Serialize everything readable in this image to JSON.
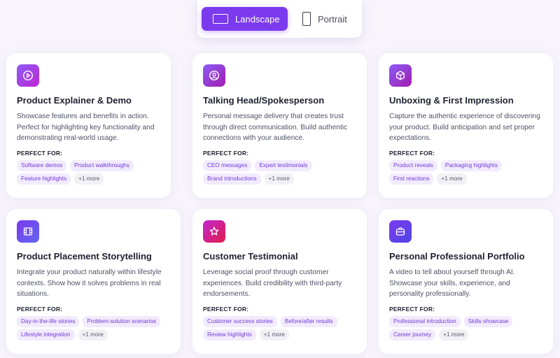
{
  "toggle": {
    "landscape_label": "Landscape",
    "portrait_label": "Portrait",
    "selected": "Landscape"
  },
  "colors": {
    "accent": "#7c3aed",
    "tag_bg": "#f2ebfd",
    "tag_text": "#7238d6",
    "page_bg": "#f7f4fc"
  },
  "perfect_for_label": "PERFECT FOR:",
  "cards": [
    {
      "icon": "play-circle-icon",
      "title": "Product Explainer & Demo",
      "description": "Showcase features and benefits in action. Perfect for highlighting key functionality and demonstrating real-world usage.",
      "tags": [
        "Software demos",
        "Product walkthroughs",
        "Feature highlights"
      ],
      "more": "+1 more"
    },
    {
      "icon": "user-circle-icon",
      "title": "Talking Head/Spokesperson",
      "description": "Personal message delivery that creates trust through direct communication. Build authentic connections with your audience.",
      "tags": [
        "CEO messages",
        "Expert testimonials",
        "Brand introductions"
      ],
      "more": "+1 more"
    },
    {
      "icon": "box-icon",
      "title": "Unboxing & First Impression",
      "description": "Capture the authentic experience of discovering your product. Build anticipation and set proper expectations.",
      "tags": [
        "Product reveals",
        "Packaging highlights",
        "First reactions"
      ],
      "more": "+1 more"
    },
    {
      "icon": "film-icon",
      "title": "Product Placement Storytelling",
      "description": "Integrate your product naturally within lifestyle contexts. Show how it solves problems in real situations.",
      "tags": [
        "Day-in-the-life stories",
        "Problem-solution scenarios",
        "Lifestyle integration"
      ],
      "more": "+1 more"
    },
    {
      "icon": "star-icon",
      "title": "Customer Testimonial",
      "description": "Leverage social proof through customer experiences. Build credibility with third-party endorsements.",
      "tags": [
        "Customer success stories",
        "Before/after results",
        "Review highlights"
      ],
      "more": "+1 more"
    },
    {
      "icon": "briefcase-icon",
      "title": "Personal Professional Portfolio",
      "description": "A video to tell about yourself through AI. Showcase your skills, experience, and personality professionally.",
      "tags": [
        "Professional introduction",
        "Skills showcase",
        "Career journey"
      ],
      "more": "+1 more"
    }
  ]
}
